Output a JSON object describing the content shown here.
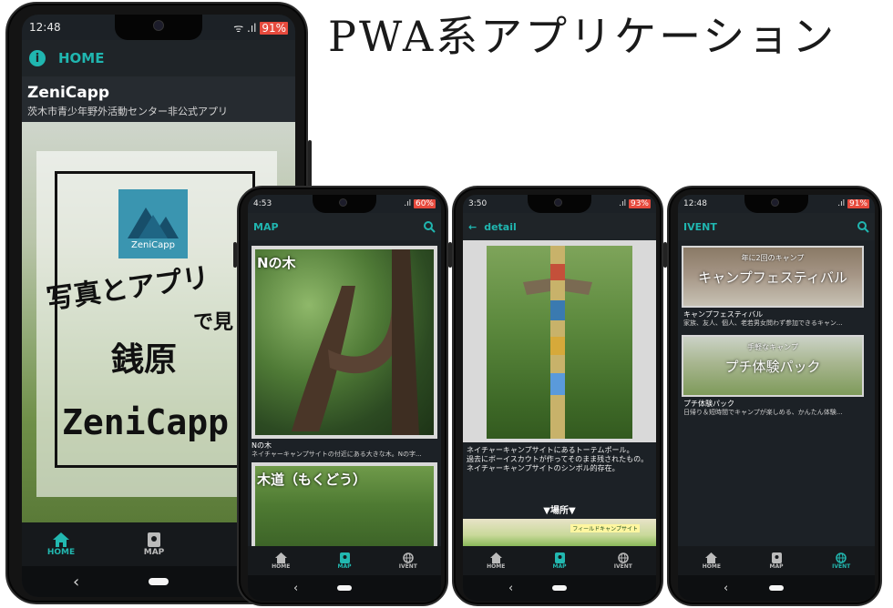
{
  "headline": "PWA系アプリケーション",
  "phone_home": {
    "status": {
      "time": "12:48",
      "battery": "91%"
    },
    "appbar": {
      "title": "HOME",
      "icon": "info-icon"
    },
    "app_name": "ZeniCapp",
    "app_subtitle": "茨木市青少年野外活動センター非公式アプリ",
    "logo_label": "ZeniCapp",
    "hero_lines": [
      "写真とアプリ",
      "で見",
      "銭原",
      "ZeniCapp"
    ],
    "nav": [
      {
        "label": "HOME",
        "icon": "home-icon",
        "active": true
      },
      {
        "label": "MAP",
        "icon": "map-icon",
        "active": false
      }
    ],
    "sys_back": "‹"
  },
  "phone_map": {
    "status": {
      "time": "4:53",
      "battery": "60%"
    },
    "appbar": {
      "title": "MAP",
      "icon": "search-icon"
    },
    "cards": [
      {
        "overlay": "Nの木",
        "title": "Nの木",
        "desc": "ネイチャーキャンプサイトの付近にある大きな木。Nの字..."
      },
      {
        "overlay": "木道（もくどう）",
        "title": "",
        "desc": ""
      }
    ],
    "nav": [
      {
        "label": "HOME",
        "icon": "home-icon",
        "active": false
      },
      {
        "label": "MAP",
        "icon": "map-icon",
        "active": true
      },
      {
        "label": "IVENT",
        "icon": "globe-icon",
        "active": false
      }
    ],
    "sys_back": "‹"
  },
  "phone_detail": {
    "status": {
      "time": "3:50",
      "battery": "93%"
    },
    "appbar": {
      "title": "detail",
      "icon": "back-arrow-icon"
    },
    "description": "ネイチャーキャンプサイトにあるトーテムポール。\n過去にボーイスカウトが作ってそのまま残されたもの。\nネイチャーキャンプサイトのシンボル的存在。",
    "location_label": "▼場所▼",
    "map_label": "フィールドキャンプサイト",
    "nav": [
      {
        "label": "HOME",
        "icon": "home-icon",
        "active": false
      },
      {
        "label": "MAP",
        "icon": "map-icon",
        "active": true
      },
      {
        "label": "IVENT",
        "icon": "globe-icon",
        "active": false
      }
    ],
    "sys_back": "‹"
  },
  "phone_event": {
    "status": {
      "time": "12:48",
      "battery": "91%"
    },
    "appbar": {
      "title": "IVENT",
      "icon": "search-icon"
    },
    "events": [
      {
        "kicker": "年に2回のキャンプ",
        "overlay": "キャンプフェスティバル",
        "title": "キャンプフェスティバル",
        "desc": "家族、友人、個人、老若男女問わず参加できるキャン..."
      },
      {
        "kicker": "手軽なキャンプ",
        "overlay": "プチ体験パック",
        "title": "プチ体験パック",
        "desc": "日帰り＆短時間でキャンプが楽しめる、かんたん体験..."
      }
    ],
    "nav": [
      {
        "label": "HOME",
        "icon": "home-icon",
        "active": false
      },
      {
        "label": "MAP",
        "icon": "map-icon",
        "active": false
      },
      {
        "label": "IVENT",
        "icon": "globe-icon",
        "active": true
      }
    ],
    "sys_back": "‹"
  },
  "colors": {
    "accent": "#22b8b0",
    "appbar_bg": "#1f2428",
    "screen_bg": "#1c2126",
    "navbar_bg": "#16191c"
  }
}
